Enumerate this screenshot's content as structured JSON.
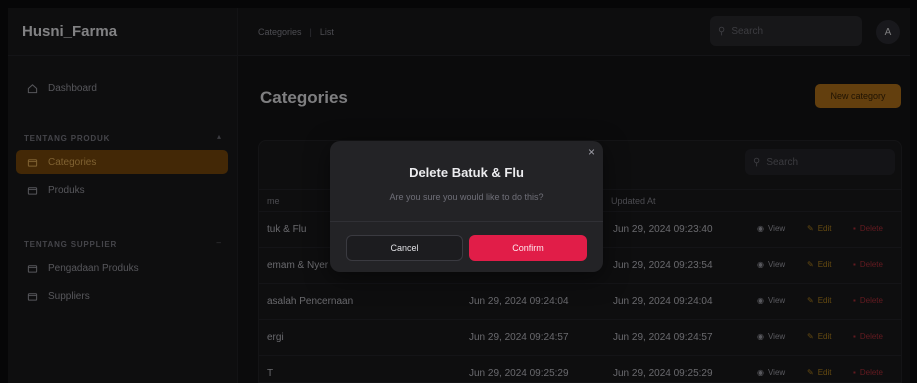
{
  "app": {
    "brand": "Husni_Farma"
  },
  "sidebar": {
    "dashboard": "Dashboard",
    "group1": "TENTANG PRODUK",
    "items1": [
      "Categories",
      "Produks"
    ],
    "group2": "TENTANG SUPPLIER",
    "items2": [
      "Pengadaan Produks",
      "Suppliers"
    ]
  },
  "topbar": {
    "crumb1": "Categories",
    "crumb2": "List",
    "search_placeholder": "Search",
    "avatar": "A"
  },
  "main": {
    "title": "Categories",
    "new_button": "New category",
    "search_placeholder": "Search",
    "columns": {
      "name": "me",
      "updated": "Updated At"
    },
    "rows": [
      {
        "name": "tuk & Flu",
        "created": "",
        "updated": "Jun 29, 2024 09:23:40"
      },
      {
        "name": "emam & Nyer",
        "created": "",
        "updated": "Jun 29, 2024 09:23:54"
      },
      {
        "name": "asalah Pencernaan",
        "created": "Jun 29, 2024 09:24:04",
        "updated": "Jun 29, 2024 09:24:04"
      },
      {
        "name": "ergi",
        "created": "Jun 29, 2024 09:24:57",
        "updated": "Jun 29, 2024 09:24:57"
      },
      {
        "name": "T",
        "created": "Jun 29, 2024 09:25:29",
        "updated": "Jun 29, 2024 09:25:29"
      }
    ],
    "actions": {
      "view": "View",
      "edit": "Edit",
      "delete": "Delete"
    }
  },
  "modal": {
    "close": "×",
    "title": "Delete Batuk & Flu",
    "description": "Are you sure you would like to do this?",
    "cancel": "Cancel",
    "confirm": "Confirm"
  },
  "colors": {
    "accent": "#b5741a",
    "danger": "#e11d48",
    "background": "#141416"
  }
}
